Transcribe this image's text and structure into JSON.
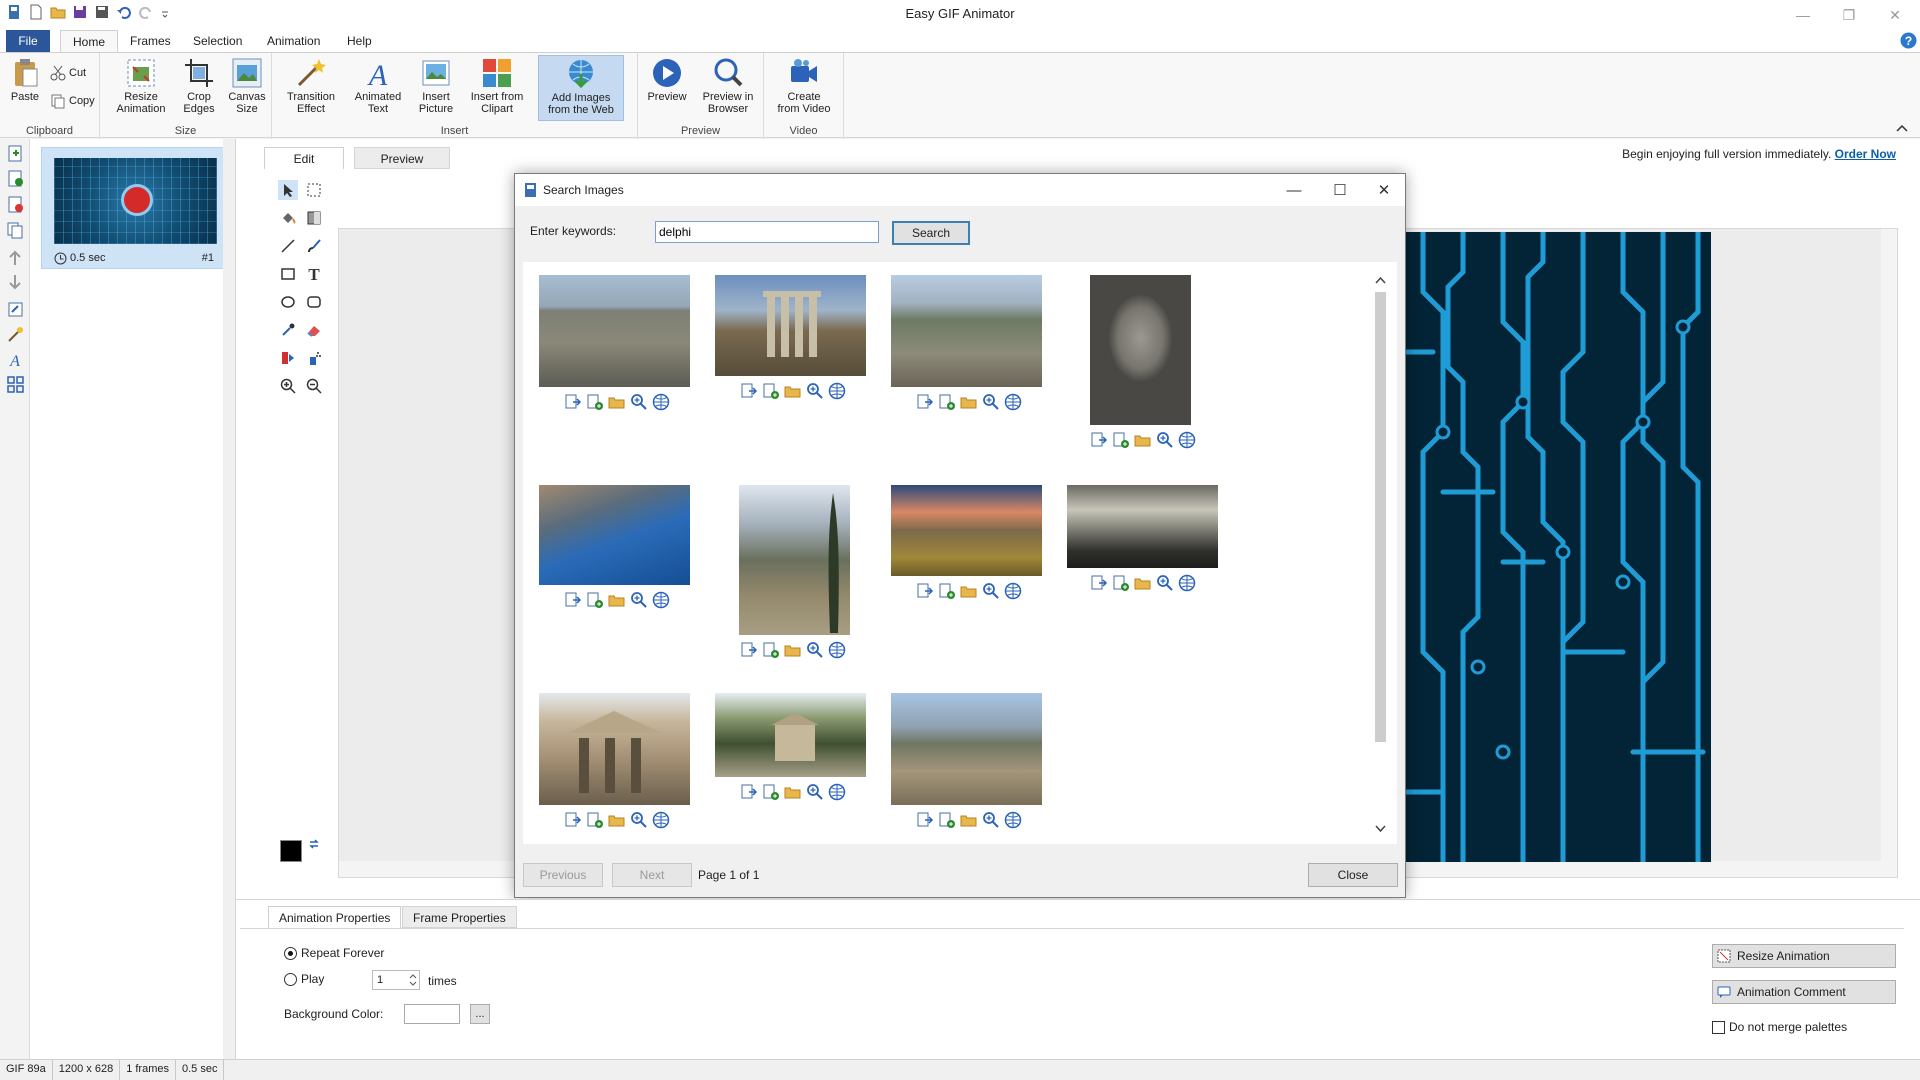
{
  "app": {
    "title": "Easy GIF Animator"
  },
  "ribbon": {
    "tabs": [
      "File",
      "Home",
      "Frames",
      "Selection",
      "Animation",
      "Help"
    ],
    "clipboard": {
      "paste": "Paste",
      "cut": "Cut",
      "copy": "Copy",
      "group": "Clipboard"
    },
    "size": {
      "resize": [
        "Resize",
        "Animation"
      ],
      "crop": [
        "Crop",
        "Edges"
      ],
      "canvas": [
        "Canvas",
        "Size"
      ],
      "group": "Size"
    },
    "insert": {
      "transition": [
        "Transition",
        "Effect"
      ],
      "text": [
        "Animated",
        "Text"
      ],
      "picture": [
        "Insert",
        "Picture"
      ],
      "clipart": [
        "Insert from",
        "Clipart"
      ],
      "web": [
        "Add Images",
        "from the Web"
      ],
      "group": "Insert"
    },
    "preview": {
      "preview": "Preview",
      "browser": [
        "Preview in",
        "Browser"
      ],
      "group": "Preview"
    },
    "video": {
      "create": [
        "Create",
        "from Video"
      ],
      "group": "Video"
    }
  },
  "frames": [
    {
      "duration": "0.5 sec",
      "number": "#1"
    }
  ],
  "editor": {
    "tabs": [
      "Edit",
      "Preview"
    ],
    "order_message": "Begin enjoying full version immediately.",
    "order_link": "Order Now"
  },
  "dialog": {
    "title": "Search Images",
    "keywords_label": "Enter keywords:",
    "keywords_value": "delphi",
    "search_button": "Search",
    "previous_button": "Previous",
    "next_button": "Next",
    "page_info": "Page 1 of 1",
    "close_button": "Close",
    "results_count": 11
  },
  "properties": {
    "tabs": [
      "Animation Properties",
      "Frame Properties"
    ],
    "repeat_forever": "Repeat Forever",
    "play": "Play",
    "play_count": "1",
    "times": "times",
    "background_color": "Background Color:",
    "browse": "...",
    "resize_animation": "Resize Animation",
    "animation_comment": "Animation Comment",
    "no_merge": "Do not merge palettes"
  },
  "status": [
    "GIF 89a",
    "1200 x 628",
    "1 frames",
    "0.5 sec"
  ],
  "colors": {
    "accent": "#2b579a",
    "selected_ribbon": "#c5d9f1",
    "circuit_bg": "#032436",
    "circuit_line": "#1f9bd6"
  }
}
